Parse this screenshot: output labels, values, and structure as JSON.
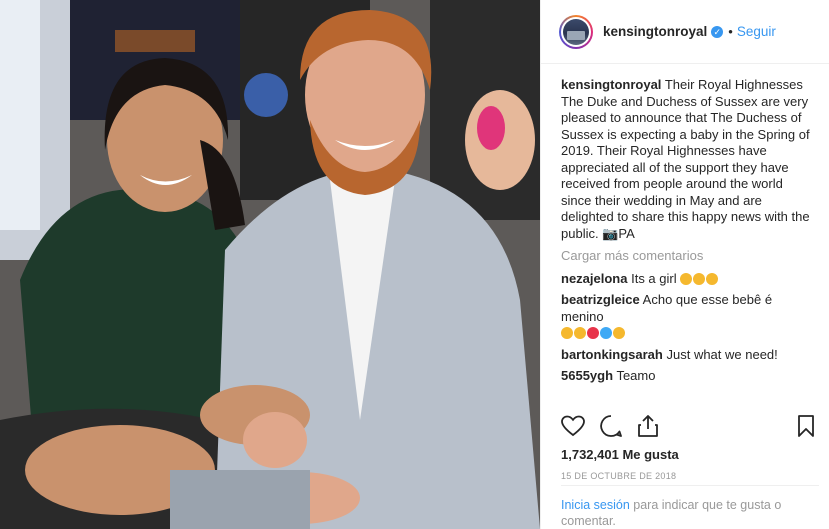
{
  "header": {
    "username": "kensingtonroyal",
    "verified_icon": "verified-badge-icon",
    "separator": "•",
    "follow_label": "Seguir"
  },
  "caption": {
    "username": "kensingtonroyal",
    "text": "Their Royal Highnesses The Duke and Duchess of Sussex are very pleased to announce that The Duchess of Sussex is expecting a baby in the Spring of 2019. Their Royal Highnesses have appreciated all of the support they have received from people around the world since their wedding in May and are delighted to share this happy news with the public. 📷PA"
  },
  "load_more_label": "Cargar más comentarios",
  "comments": [
    {
      "username": "nezajelona",
      "text": "Its a girl",
      "emojis": [
        "#f5b82e",
        "#f5b82e",
        "#f5b82e"
      ]
    },
    {
      "username": "beatrizgleice",
      "text": "Acho que esse bebê é menino",
      "emojis": [
        "#f5b82e",
        "#f5b82e",
        "#e8334a",
        "#3fa9f5",
        "#f5b82e"
      ]
    },
    {
      "username": "bartonkingsarah",
      "text": "Just what we need!",
      "emojis": []
    },
    {
      "username": "5655ygh",
      "text": "Teamo",
      "emojis": []
    }
  ],
  "actions": {
    "like_icon": "heart-icon",
    "comment_icon": "comment-icon",
    "share_icon": "share-icon",
    "save_icon": "bookmark-icon"
  },
  "likes_text": "1,732,401 Me gusta",
  "date_text": "15 DE OCTUBRE DE 2018",
  "login": {
    "link_label": "Inicia sesión",
    "rest_text": "para indicar que te gusta o comentar."
  },
  "colors": {
    "accent": "#3897f0",
    "muted": "#999999",
    "text": "#262626"
  }
}
